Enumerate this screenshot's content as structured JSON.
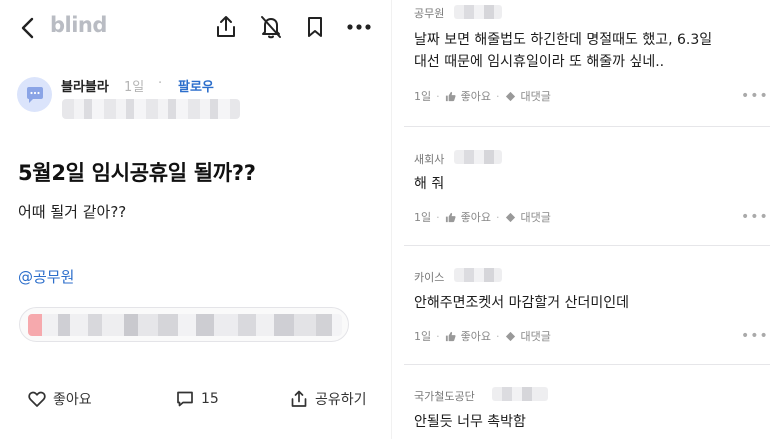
{
  "app": {
    "logo": "blind"
  },
  "post": {
    "author": "블라블라",
    "time": "1일",
    "separator": "·",
    "follow_label": "팔로우",
    "title": "5월2일 임시공휴일 될까??",
    "body": "어때 될거 같아??",
    "tag": "@공무원"
  },
  "actions": {
    "like_label": "좋아요",
    "comment_count": "15",
    "share_label": "공유하기"
  },
  "comments": [
    {
      "author": "공무원",
      "text": "날짜 보면 해줄법도 하긴한데 명절때도 했고, 6.3일\n대선 때문에 임시휴일이라 또 해줄까 싶네..",
      "time": "1일",
      "like_label": "좋아요",
      "reply_label": "대댓글"
    },
    {
      "author": "새회사",
      "text": "해 줘",
      "time": "1일",
      "like_label": "좋아요",
      "reply_label": "대댓글"
    },
    {
      "author": "카이스",
      "text": "안해주면조켓서 마감할거 산더미인데",
      "time": "1일",
      "like_label": "좋아요",
      "reply_label": "대댓글"
    },
    {
      "author": "국가철도공단",
      "text": "안될듯 너무 촉박함"
    }
  ],
  "icons": {
    "back": "back-arrow-icon",
    "share": "share-icon",
    "bell_off": "bell-off-icon",
    "bookmark": "bookmark-icon",
    "more": "more-icon",
    "heart": "heart-icon",
    "comment": "comment-icon",
    "thumb": "thumbs-up-icon",
    "reply": "reply-icon"
  },
  "colors": {
    "accent": "#2c6ecb",
    "logo": "#b9bcc3",
    "avatar_bg": "#dbe4fb"
  }
}
